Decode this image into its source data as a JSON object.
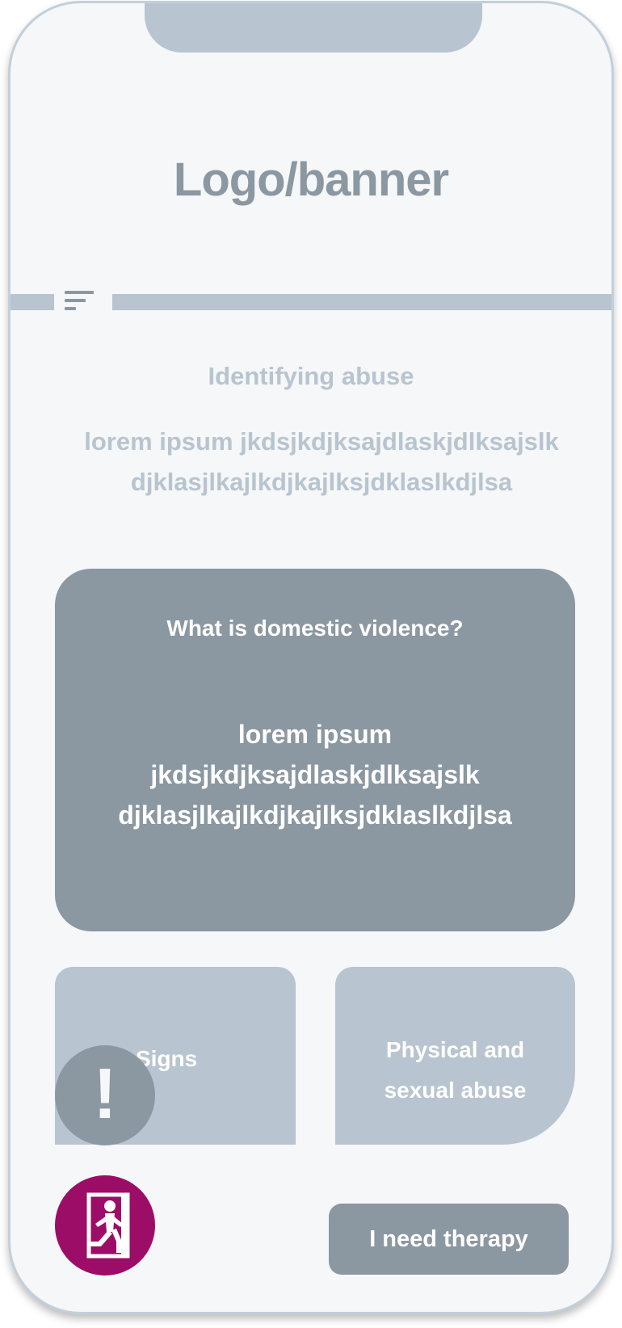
{
  "header": {
    "banner_text": "Logo/banner"
  },
  "nav": {
    "menu_icon": "sort-lines-icon"
  },
  "intro": {
    "title": "Identifying abuse",
    "body": "lorem ipsum jkdsjkdjksajdlaskjdlksajslk\ndjklasjlkajlkdjkajlksjdklaslkdjlsa"
  },
  "main_card": {
    "title": "What is domestic violence?",
    "body": "lorem ipsum\njkdsjkdjksajdlaskjdlksajslk\ndjklasjlkajlkdjkajlksjdklaslkdjlsa"
  },
  "tiles": [
    {
      "label": "Signs"
    },
    {
      "label": "Physical and\nsexual abuse"
    }
  ],
  "alert_button": {
    "glyph": "!",
    "icon": "exclamation-icon"
  },
  "exit_button": {
    "icon": "emergency-exit-icon"
  },
  "therapy_button": {
    "label": "I need therapy"
  },
  "colors": {
    "background": "#f5f7f9",
    "dark_gray": "#8b97a1",
    "light_gray": "#b8c4cf",
    "exit_magenta": "#9c0d67",
    "text_white": "#ffffff"
  }
}
